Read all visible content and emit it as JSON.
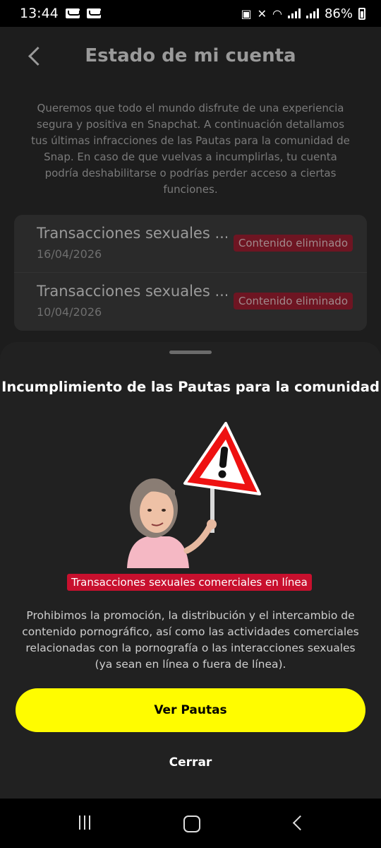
{
  "status_bar": {
    "time": "13:44",
    "battery": "86%",
    "icons": [
      "voicemail-icon",
      "voicemail-icon",
      "battery-saver-icon",
      "mute-icon",
      "wifi-icon",
      "signal-icon",
      "signal-icon",
      "battery-icon"
    ]
  },
  "header": {
    "title": "Estado de mi cuenta"
  },
  "intro": "Queremos que todo el mundo disfrute de una experiencia segura y positiva en Snapchat. A continuación detallamos tus últimas infracciones de las Pautas para la comunidad de Snap. En caso de que vuelvas a incumplirlas, tu cuenta podría deshabilitarse o podrías perder acceso a ciertas funciones.",
  "violations": [
    {
      "title": "Transacciones sexuales ...",
      "date": "16/04/2026",
      "badge": "Contenido eliminado"
    },
    {
      "title": "Transacciones sexuales ...",
      "date": "10/04/2026",
      "badge": "Contenido eliminado"
    }
  ],
  "sheet": {
    "title": "Incumplimiento de las Pautas para la comunidad",
    "badge": "Transacciones sexuales comerciales en línea",
    "body": "Prohibimos la promoción, la distribución y el intercambio de contenido pornográfico, así como las actividades comerciales relacionadas con la pornografía o las interacciones sexuales (ya sean en línea o fuera de línea).",
    "primary_button": "Ver Pautas",
    "secondary_button": "Cerrar"
  },
  "colors": {
    "accent_yellow": "#fffc00",
    "badge_red": "#c8102e",
    "sheet_bg": "#212121"
  }
}
